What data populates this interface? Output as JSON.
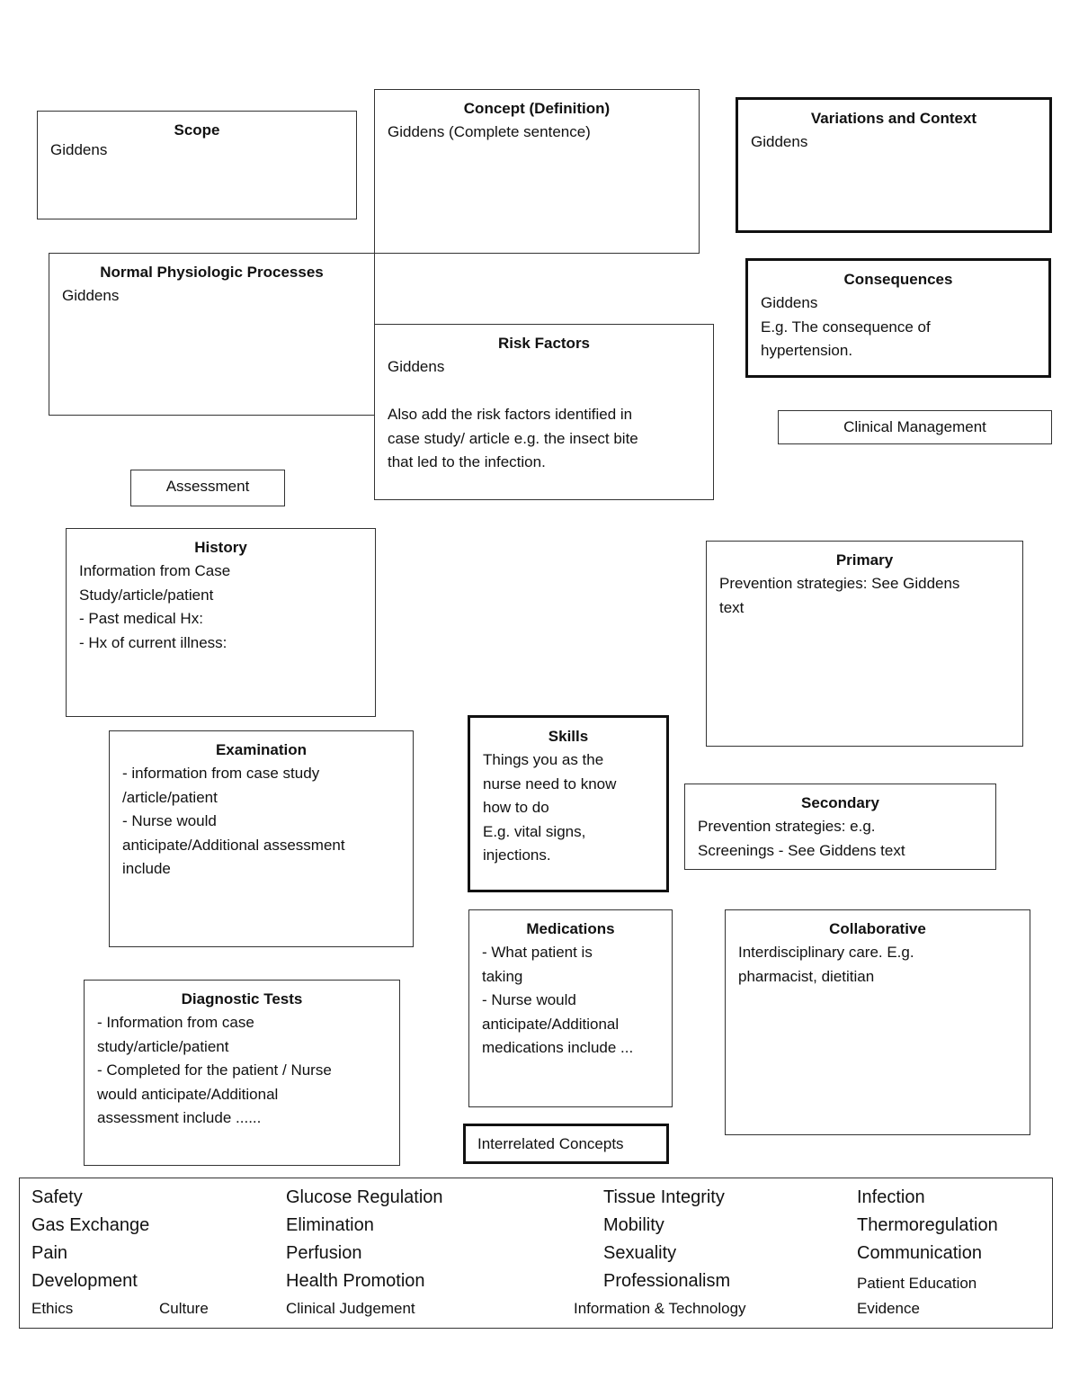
{
  "boxes": {
    "scope": {
      "title": "Scope",
      "body": "Giddens"
    },
    "concept": {
      "title": "Concept (Definition)",
      "body": "Giddens (Complete sentence)"
    },
    "variations": {
      "title": "Variations and Context",
      "body": "Giddens"
    },
    "normal_physiologic": {
      "title": "Normal Physiologic Processes",
      "body": "Giddens"
    },
    "consequences": {
      "title": "Consequences",
      "body": "Giddens\nE.g. The consequence of\nhypertension."
    },
    "risk_factors": {
      "title": "Risk Factors",
      "body": "Giddens\n\nAlso add the risk factors identified in\ncase study/ article e.g. the insect bite\nthat led to the infection."
    },
    "history": {
      "title": "History",
      "body": "Information from Case\nStudy/article/patient\n- Past medical Hx:\n- Hx of current illness:"
    },
    "primary": {
      "title": "Primary",
      "body": "Prevention strategies: See Giddens\ntext"
    },
    "examination": {
      "title": "Examination",
      "body": "- information from case study\n/article/patient\n- Nurse would\nanticipate/Additional assessment\ninclude"
    },
    "skills": {
      "title": "Skills",
      "body": "Things you as the\nnurse need to know\nhow to do\nE.g. vital signs,\ninjections."
    },
    "secondary": {
      "title": "Secondary",
      "body": "Prevention strategies: e.g.\nScreenings -  See Giddens text"
    },
    "medications": {
      "title": "Medications",
      "body": "- What patient is\ntaking\n- Nurse would\nanticipate/Additional\nmedications include ..."
    },
    "collaborative": {
      "title": "Collaborative",
      "body": "Interdisciplinary care. E.g.\npharmacist, dietitian"
    },
    "diagnostic_tests": {
      "title": "Diagnostic Tests",
      "body": "- Information from case\nstudy/article/patient\n- Completed for the patient  / Nurse\nwould anticipate/Additional\nassessment include ......"
    }
  },
  "labels": {
    "assessment": "Assessment",
    "clinical_management": "Clinical Management",
    "interrelated_concepts": "Interrelated Concepts"
  },
  "interrelated_concepts": {
    "col1": [
      "Safety",
      "Gas Exchange",
      "Pain",
      "Development"
    ],
    "col2": [
      "Glucose Regulation",
      "Elimination",
      "Perfusion",
      "Health Promotion"
    ],
    "col3": [
      "Tissue Integrity",
      "Mobility",
      "Sexuality",
      "Professionalism"
    ],
    "col4": [
      "Infection",
      "Thermoregulation",
      "Communication",
      "Patient Education"
    ],
    "bottom_row": [
      "Ethics",
      "Culture",
      "Clinical Judgement",
      "Information & Technology",
      "Evidence"
    ]
  }
}
